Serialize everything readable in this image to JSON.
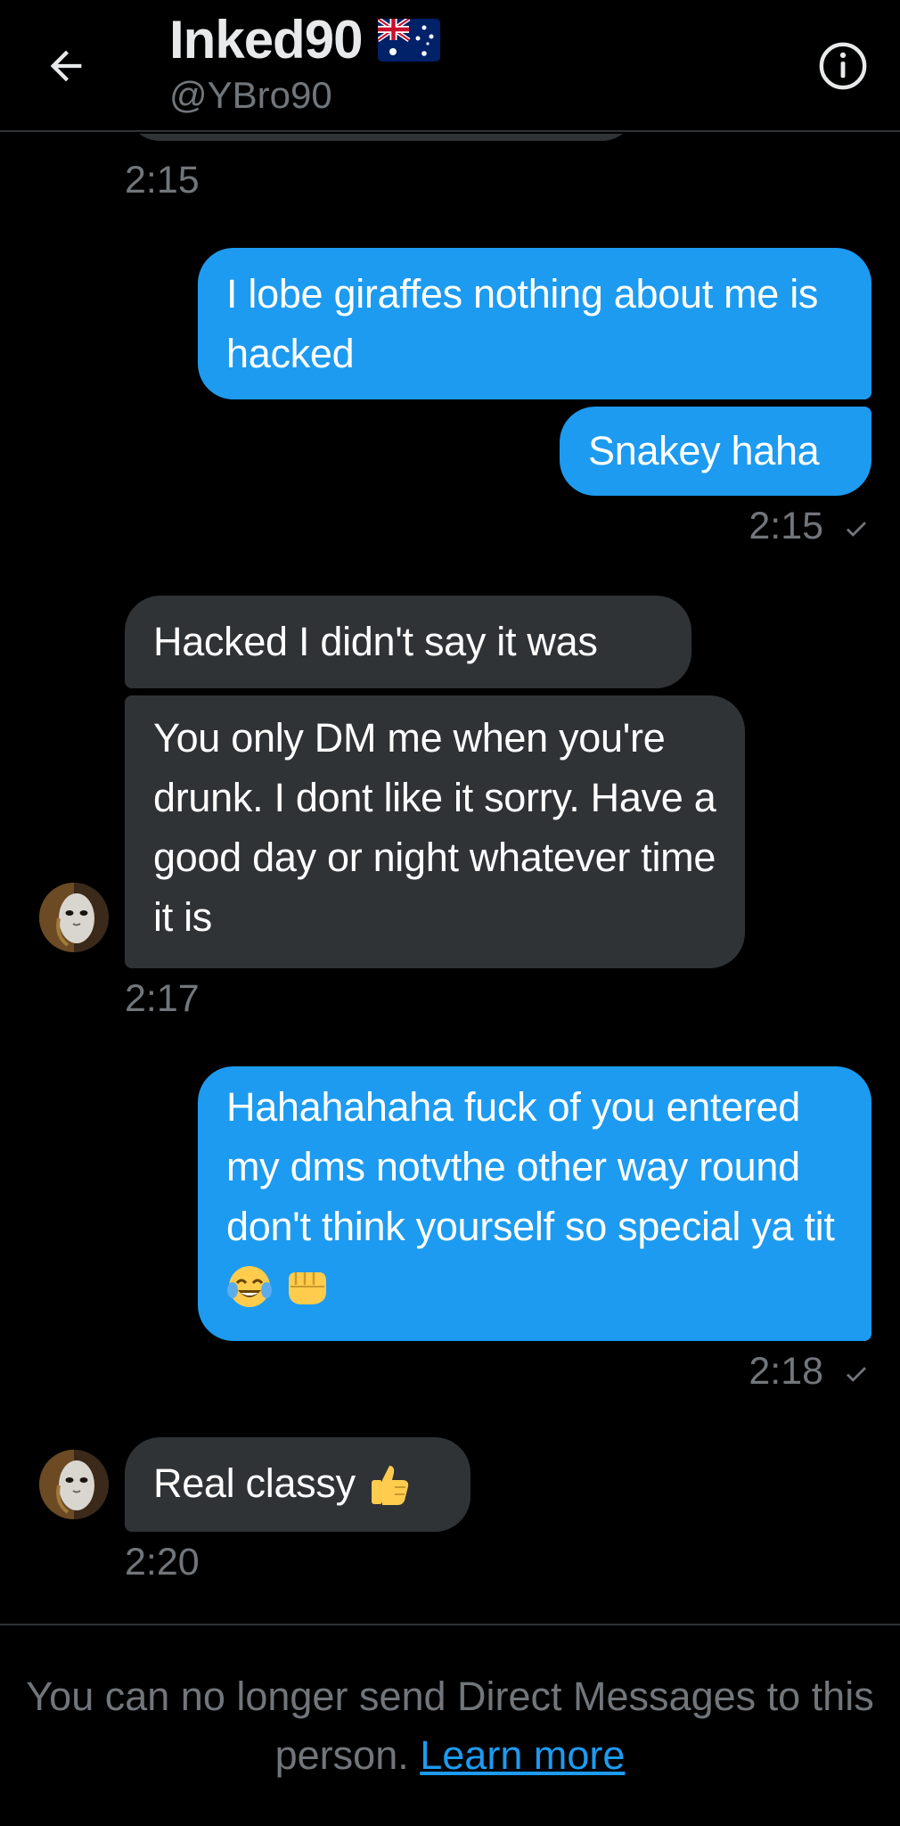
{
  "header": {
    "title": "Inked90",
    "handle": "@YBro90",
    "back_icon": "arrow-left-icon",
    "flag_icon": "australia-flag-icon",
    "info_icon": "info-icon"
  },
  "colors": {
    "background": "#000000",
    "outgoing_bubble": "#1d9bf0",
    "incoming_bubble": "#2f3336",
    "muted_text": "#71767b",
    "link": "#1d9bf0"
  },
  "messages": [
    {
      "direction": "in",
      "time": "2:15"
    },
    {
      "direction": "out",
      "text": "I lobe giraffes nothing about me is hacked"
    },
    {
      "direction": "out",
      "text": "Snakey haha",
      "time": "2:15"
    },
    {
      "direction": "in",
      "text": "Hacked I didn't say it was"
    },
    {
      "direction": "in",
      "text": "You only DM me when you're drunk. I dont like it sorry. Have a good day or night whatever time it is",
      "time": "2:17"
    },
    {
      "direction": "out",
      "text": "Hahahahaha fuck of you entered my dms notvthe other way round don't think yourself so special ya tit",
      "emojis": [
        "tears-of-joy-emoji",
        "fist-bump-emoji"
      ],
      "time": "2:18"
    },
    {
      "direction": "in",
      "text": "Real classy",
      "emojis": [
        "thumbs-up-emoji"
      ],
      "time": "2:20"
    }
  ],
  "footer": {
    "notice": "You can no longer send Direct Messages to this person.",
    "link": "Learn more"
  }
}
